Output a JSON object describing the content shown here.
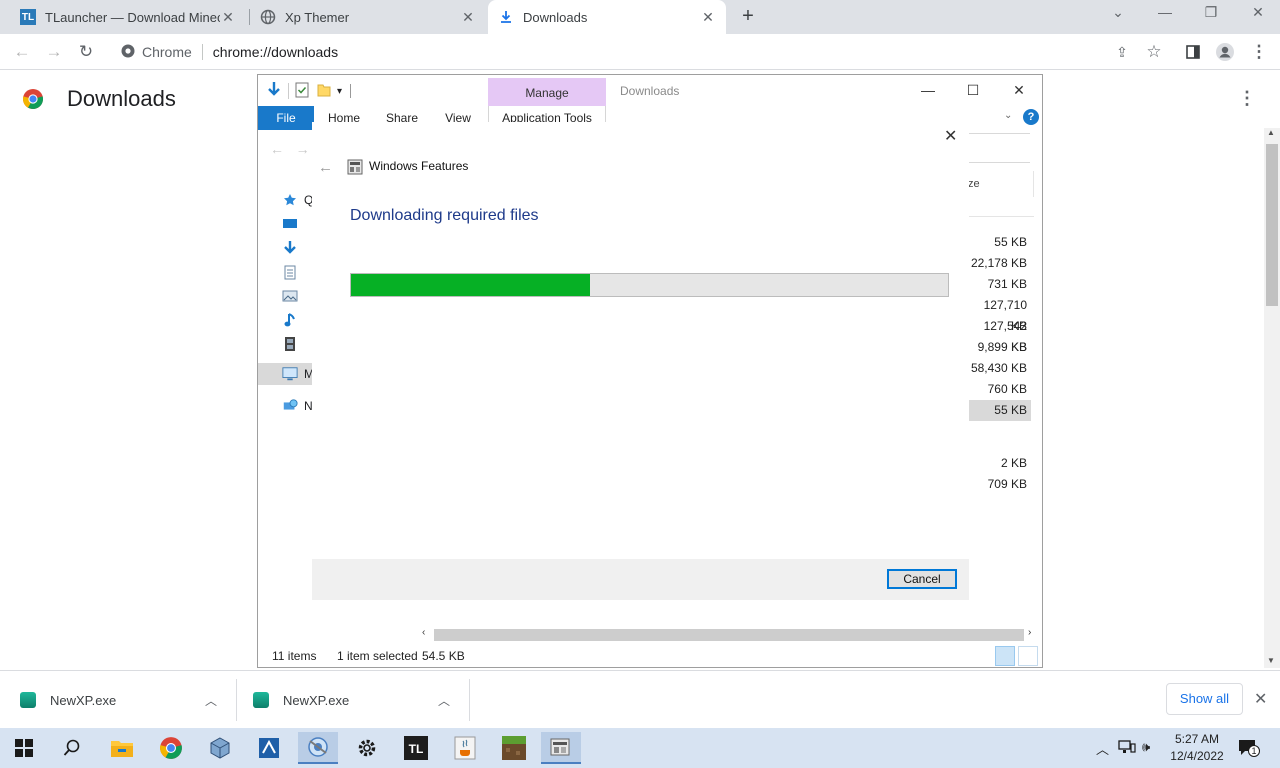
{
  "browser": {
    "tabs": [
      {
        "title": "TLauncher — Download Minecra",
        "favicon": "TL"
      },
      {
        "title": "Xp Themer",
        "favicon": "globe-icon"
      },
      {
        "title": "Downloads",
        "favicon": "download-icon",
        "active": true
      }
    ],
    "omnibox": {
      "site_label": "Chrome",
      "url": "chrome://downloads"
    }
  },
  "downloads_page": {
    "title": "Downloads"
  },
  "explorer": {
    "title": "Downloads",
    "context_tab": "Manage",
    "ribbon_tabs": [
      "File",
      "Home",
      "Share",
      "View",
      "Application Tools"
    ],
    "column_header": "ze",
    "nav_items": [
      {
        "icon": "quick-access-icon",
        "label": "Q"
      },
      {
        "icon": "desktop-icon",
        "label": ""
      },
      {
        "icon": "downloads-icon",
        "label": ""
      },
      {
        "icon": "documents-icon",
        "label": ""
      },
      {
        "icon": "pictures-icon",
        "label": ""
      },
      {
        "icon": "music-icon",
        "label": ""
      },
      {
        "icon": "videos-icon",
        "label": ""
      },
      {
        "icon": "this-pc-icon",
        "label": "M"
      },
      {
        "icon": "network-icon",
        "label": "N"
      }
    ],
    "sizes": [
      "55 KB",
      "22,178 KB",
      "731 KB",
      "127,710 KB",
      "127,542 KB",
      "9,899 KB",
      "58,430 KB",
      "760 KB",
      "55 KB"
    ],
    "sizes_lower": [
      "2 KB",
      "709 KB"
    ],
    "status": {
      "items": "11 items",
      "selected": "1 item selected",
      "size": "54.5 KB"
    }
  },
  "dialog": {
    "heading": "Windows Features",
    "message": "Downloading required files",
    "progress_percent": 40,
    "cancel_label": "Cancel"
  },
  "shelf": {
    "items": [
      {
        "name": "NewXP.exe"
      },
      {
        "name": "NewXP.exe"
      }
    ],
    "show_all": "Show all"
  },
  "taskbar": {
    "clock_time": "5:27 AM",
    "clock_date": "12/4/2022",
    "notification_count": "1"
  }
}
